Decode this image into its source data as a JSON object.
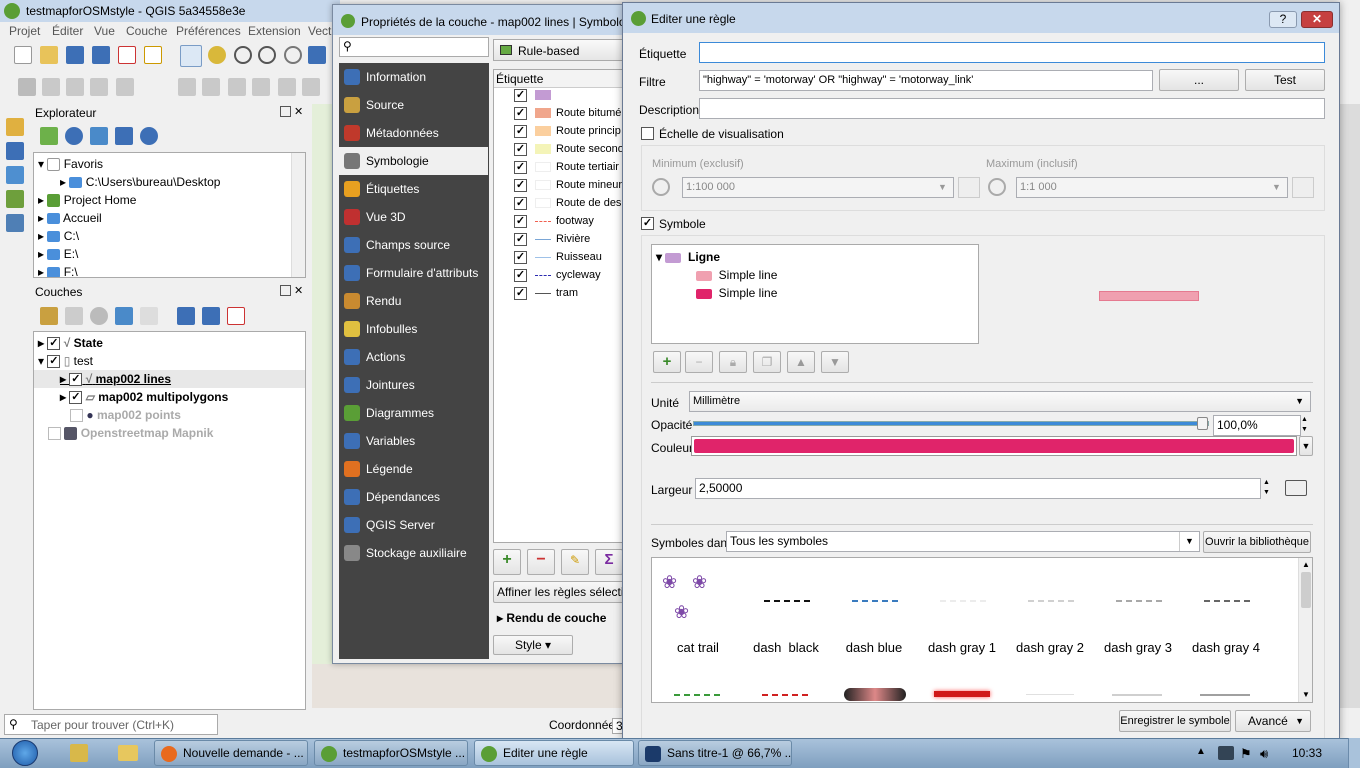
{
  "main_window": {
    "title": "testmapforOSMstyle - QGIS 5a34558e3e",
    "menu": [
      "Projet",
      "Éditer",
      "Vue",
      "Couche",
      "Préférences",
      "Extension",
      "Vect"
    ]
  },
  "browser": {
    "title": "Explorateur",
    "items": [
      "Favoris",
      "C:\\Users\\bureau\\Desktop",
      "Project Home",
      "Accueil",
      "C:\\",
      "E:\\",
      "F:\\"
    ]
  },
  "layers": {
    "title": "Couches",
    "items": [
      "State",
      "test",
      "map002 lines",
      "map002 multipolygons",
      "map002 points",
      "Openstreetmap Mapnik"
    ]
  },
  "search": {
    "placeholder": "Taper pour trouver (Ctrl+K)"
  },
  "status": {
    "coords": "Coordonnée",
    "coords_val": "3"
  },
  "props": {
    "title": "Propriétés de la couche - map002 lines | Symbolo",
    "renderer": "Rule-based",
    "col_header": "Étiquette",
    "sidebar": [
      "Information",
      "Source",
      "Métadonnées",
      "Symbologie",
      "Étiquettes",
      "Vue 3D",
      "Champs source",
      "Formulaire d'attributs",
      "Rendu",
      "Infobulles",
      "Actions",
      "Jointures",
      "Diagrammes",
      "Variables",
      "Légende",
      "Dépendances",
      "QGIS Server",
      "Stockage auxiliaire"
    ],
    "rules": [
      {
        "label": "",
        "color": "#c39bd3"
      },
      {
        "label": "Route bitumé",
        "color": "#f0a68c"
      },
      {
        "label": "Route princip",
        "color": "#fbcf9e"
      },
      {
        "label": "Route secono",
        "color": "#f4f4b8"
      },
      {
        "label": "Route tertiair",
        "color": "#ffffff"
      },
      {
        "label": "Route mineur",
        "color": "#ffffff"
      },
      {
        "label": "Route de des",
        "color": "#ffffff"
      },
      {
        "label": "footway",
        "color": "#f06050"
      },
      {
        "label": "Rivière",
        "color": "#7aa6d6"
      },
      {
        "label": "Ruisseau",
        "color": "#9ec1e8"
      },
      {
        "label": "cycleway",
        "color": "#2b2bb0"
      },
      {
        "label": "tram",
        "color": "#555555"
      }
    ],
    "refine_btn": "Affiner les règles sélection",
    "layer_render": "Rendu de couche",
    "style_btn": "Style"
  },
  "dialog": {
    "title": "Editer une règle",
    "help": "?",
    "label_field": "Étiquette",
    "label_value": "",
    "filter_field": "Filtre",
    "filter_value": "\"highway\" = 'motorway' OR \"highway\" = 'motorway_link'",
    "dots_btn": "...",
    "test_btn": "Test",
    "desc_field": "Description",
    "desc_value": "",
    "scale_cb": "Échelle de visualisation",
    "min_label": "Minimum (exclusif)",
    "min_value": "1:100 000",
    "max_label": "Maximum (inclusif)",
    "max_value": "1:1 000",
    "symbol_cb": "Symbole",
    "sym_tree": [
      "Ligne",
      "Simple line",
      "Simple line"
    ],
    "unit_label": "Unité",
    "unit_value": "Millimètre",
    "opacity_label": "Opacité",
    "opacity_value": "100,0%",
    "opacity_level": 1.0,
    "color_label": "Couleur",
    "color_value": "#e0246a",
    "width_label": "Largeur",
    "width_value": "2,50000",
    "symbols_in": "Symboles dans",
    "symbols_filter": "Tous les symboles",
    "open_lib": "Ouvrir la bibliothèque",
    "symbols": [
      "cat trail",
      "dash  black",
      "dash blue",
      "dash gray 1",
      "dash gray 2",
      "dash gray 3",
      "dash gray 4"
    ],
    "save_symbol": "Enregistrer le symbole",
    "advanced": "Avancé"
  },
  "taskbar": {
    "tasks": [
      "Nouvelle demande - ...",
      "testmapforOSMstyle ...",
      "Editer une règle",
      "Sans titre-1 @ 66,7% ..."
    ],
    "clock": "10:33"
  }
}
